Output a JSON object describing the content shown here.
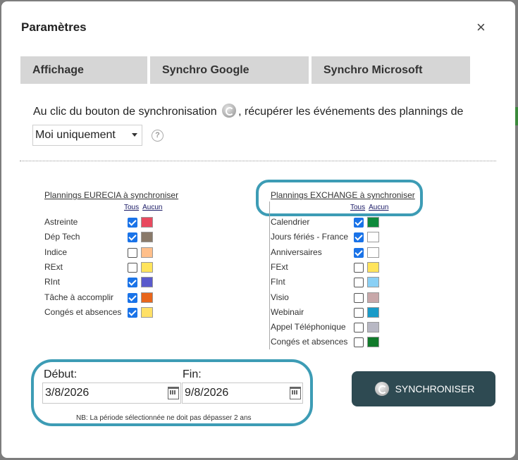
{
  "dialog": {
    "title": "Paramètres",
    "close_glyph": "×"
  },
  "tabs": [
    "Affichage",
    "Synchro Google",
    "Synchro Microsoft"
  ],
  "description": {
    "before_icon": "Au clic du bouton de synchronisation",
    "after_icon": ", récupérer les événements des plannings de"
  },
  "scope_select": {
    "value": "Moi uniquement",
    "help_glyph": "?"
  },
  "eurecia": {
    "title": "Plannings EURECIA à synchroniser",
    "tous": "Tous",
    "aucun": "Aucun",
    "items": [
      {
        "label": "Astreinte",
        "checked": true,
        "color": "#e84a5f"
      },
      {
        "label": "Dép Tech",
        "checked": true,
        "color": "#8a7a6a"
      },
      {
        "label": "Indice",
        "checked": false,
        "color": "#ffbf8a"
      },
      {
        "label": "RExt",
        "checked": false,
        "color": "#ffe45c"
      },
      {
        "label": "RInt",
        "checked": true,
        "color": "#5a5acc"
      },
      {
        "label": "Tâche à accomplir",
        "checked": true,
        "color": "#e8661c"
      },
      {
        "label": "Congés et absences",
        "checked": true,
        "color": "#ffe066"
      }
    ]
  },
  "exchange": {
    "title": "Plannings EXCHANGE à synchroniser",
    "tous": "Tous",
    "aucun": "Aucun",
    "items": [
      {
        "label": "Calendrier",
        "checked": true,
        "color": "#0f8a3c"
      },
      {
        "label": "Jours fériés - France",
        "checked": true,
        "color": "#ffffff"
      },
      {
        "label": "Anniversaires",
        "checked": true,
        "color": "#ffffff"
      },
      {
        "label": "FExt",
        "checked": false,
        "color": "#ffe45c"
      },
      {
        "label": "FInt",
        "checked": false,
        "color": "#8ad0f5"
      },
      {
        "label": "Visio",
        "checked": false,
        "color": "#c8a8aa"
      },
      {
        "label": "Webinair",
        "checked": false,
        "color": "#1a9bc8"
      },
      {
        "label": "Appel Téléphonique",
        "checked": false,
        "color": "#b8b8c4"
      },
      {
        "label": "Congés et absences",
        "checked": false,
        "color": "#107a2a"
      }
    ]
  },
  "period": {
    "start_label": "Début:",
    "start_value": "3/8/2026",
    "end_label": "Fin:",
    "end_value": "9/8/2026",
    "note": "NB: La période sélectionnée ne doit pas dépasser 2 ans"
  },
  "sync_button": {
    "label": "SYNCHRONISER"
  },
  "colors": {
    "highlight": "#3d9cb5",
    "button_bg": "#2e4a52",
    "checkbox_checked": "#1a73e8",
    "tab_bg": "#d6d6d6"
  }
}
